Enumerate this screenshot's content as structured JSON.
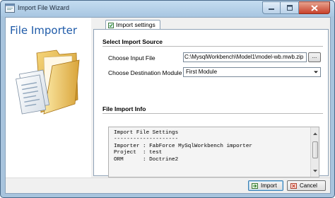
{
  "window": {
    "title": "Import File Wizard"
  },
  "sidebar": {
    "title": "File Importer"
  },
  "tab": {
    "label": "Import settings"
  },
  "source": {
    "heading": "Select Import Source",
    "input_label": "Choose Input File",
    "input_value": "C:\\MysqlWorkbench\\Model1\\model-wb.mwb.zip",
    "browse_label": "...",
    "module_label": "Choose Destination Module",
    "module_value": "First Module"
  },
  "info": {
    "heading": "File Import Info",
    "lines": [
      "Import File Settings",
      "--------------------",
      "Importer : FabForce MySqlWorkbench importer",
      "Project  : test",
      "ORM      : Doctrine2"
    ]
  },
  "footer": {
    "import_label": "Import",
    "cancel_label": "Cancel"
  }
}
